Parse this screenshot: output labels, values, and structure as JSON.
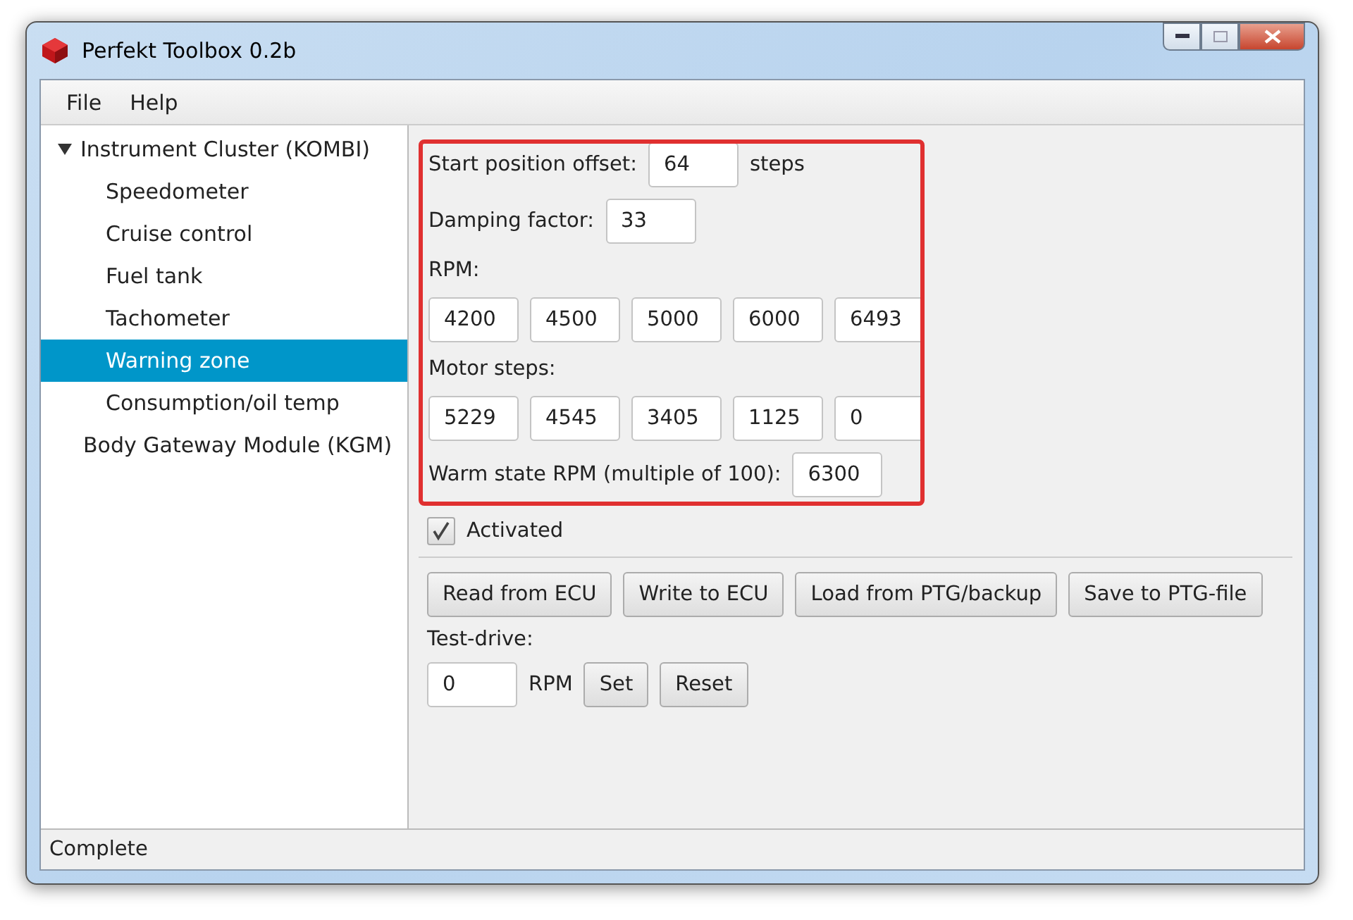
{
  "window": {
    "title": "Perfekt Toolbox 0.2b"
  },
  "menu": [
    "File",
    "Help"
  ],
  "tree": [
    {
      "label": "Instrument Cluster (KOMBI)",
      "selected": false,
      "expanded": true,
      "children": [
        {
          "label": "Speedometer",
          "selected": false
        },
        {
          "label": "Cruise control",
          "selected": false
        },
        {
          "label": "Fuel tank",
          "selected": false
        },
        {
          "label": "Tachometer",
          "selected": false
        },
        {
          "label": "Warning zone",
          "selected": true
        },
        {
          "label": "Consumption/oil temp",
          "selected": false
        }
      ]
    },
    {
      "label": "Body Gateway Module (KGM)",
      "selected": false
    }
  ],
  "form": {
    "start_offset": {
      "label": "Start position offset:",
      "value": "64",
      "unit": "steps"
    },
    "damping": {
      "label": "Damping factor:",
      "value": "33"
    },
    "rpm": {
      "label": "RPM:",
      "values": [
        "4200",
        "4500",
        "5000",
        "6000",
        "6493"
      ]
    },
    "motor_steps": {
      "label": "Motor steps:",
      "values": [
        "5229",
        "4545",
        "3405",
        "1125",
        "0"
      ]
    },
    "warm_rpm": {
      "label": "Warm state RPM (multiple of 100):",
      "value": "6300"
    }
  },
  "activated": {
    "label": "Activated",
    "checked": true
  },
  "buttons": [
    "Read from ECU",
    "Write to ECU",
    "Load from PTG/backup",
    "Save to PTG-file"
  ],
  "test_drive": {
    "label": "Test-drive:",
    "value": "0",
    "unit": "RPM",
    "buttons": [
      "Set",
      "Reset"
    ]
  },
  "status_bar": "Complete"
}
